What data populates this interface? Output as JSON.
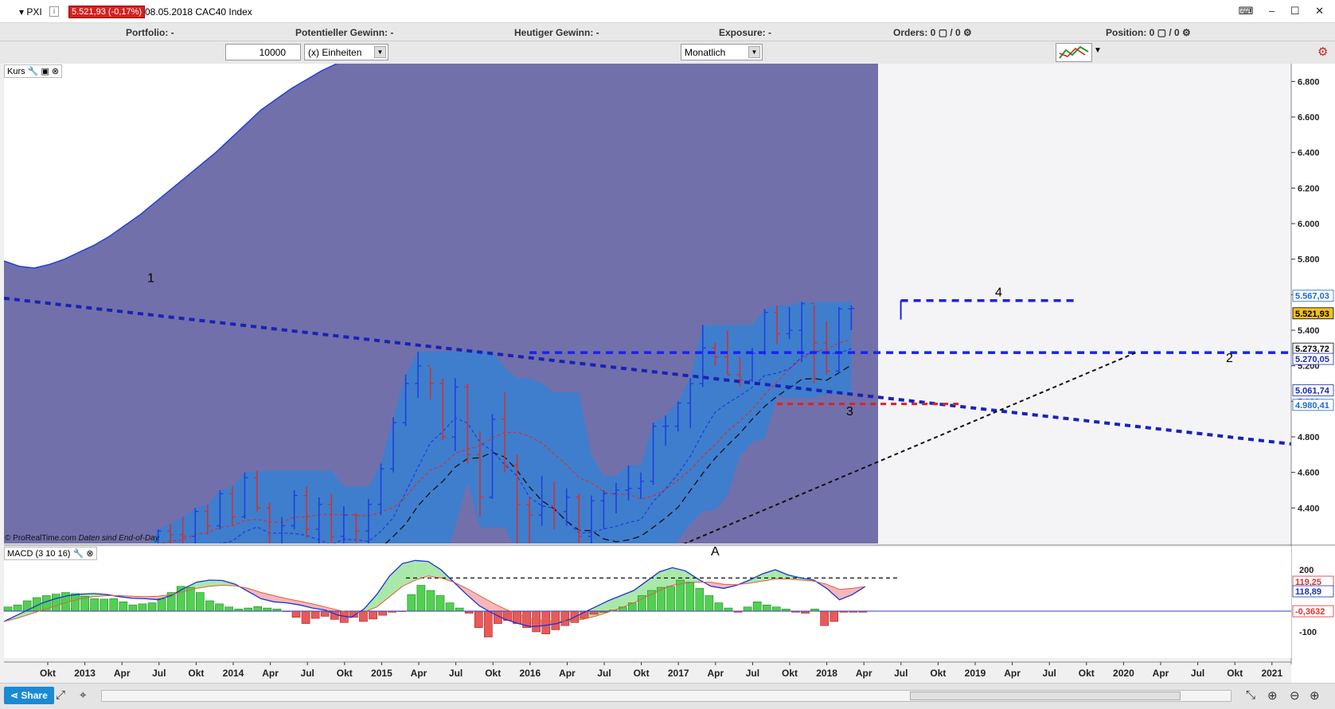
{
  "header": {
    "symbol": "▾ PXI",
    "info_label": "i",
    "price_badge": "5.521,93 (-0,17%)",
    "date_instrument": "08.05.2018 CAC40 Index",
    "window_controls": "⌨ – ☐ ✕"
  },
  "status": {
    "portfolio": "Portfolio: -",
    "potential_gain": "Potentieller Gewinn: -",
    "today_gain": "Heutiger Gewinn: -",
    "exposure": "Exposure: -",
    "orders": "Orders: 0 ▢ / 0 ⚙",
    "position": "Position: 0 ▢ / 0 ⚙"
  },
  "toolbar": {
    "quantity": "10000",
    "unit_select": "(x) Einheiten",
    "period_select": "Monatlich"
  },
  "panels": {
    "price_label": "Kurs",
    "macd_label": "MACD (3 10 16)",
    "copyright": "© ProRealTime.com",
    "copyright_note": "Daten sind End-of-Day"
  },
  "bottom": {
    "share_label": "Share"
  },
  "colors": {
    "band_fill": "#3a7fd0",
    "purple_bg": "#7270aa",
    "bar_up": "#1f3fe0",
    "bar_down": "#d43030",
    "trend_line": "#1a22b8",
    "macd_pos": "#52d052",
    "macd_neg": "#e85a5a"
  },
  "chart_data": {
    "type": "bar",
    "title": "CAC40 Index",
    "period": "Monatlich",
    "ylim": [
      4200,
      6900
    ],
    "y_ticks": [
      "4.400",
      "4.600",
      "4.800",
      "5.000",
      "5.200",
      "5.400",
      "5.600",
      "5.800",
      "6.000",
      "6.200",
      "6.400",
      "6.600",
      "6.800"
    ],
    "x_ticks": [
      "Okt",
      "2013",
      "Apr",
      "Jul",
      "Okt",
      "2014",
      "Apr",
      "Jul",
      "Okt",
      "2015",
      "Apr",
      "Jul",
      "Okt",
      "2016",
      "Apr",
      "Jul",
      "Okt",
      "2017",
      "Apr",
      "Jul",
      "Okt",
      "2018",
      "Apr",
      "Jul",
      "Okt",
      "2019",
      "Apr",
      "Jul",
      "Okt",
      "2020",
      "Apr",
      "Jul",
      "Okt",
      "2021"
    ],
    "price_labels": [
      {
        "text": "5.567,03",
        "value": 5567,
        "style": "blue"
      },
      {
        "text": "5.521,93",
        "value": 5522,
        "style": "current"
      },
      {
        "text": "5.273,72",
        "value": 5274,
        "style": "black"
      },
      {
        "text": "5.270,05",
        "value": 5270,
        "style": "navy"
      },
      {
        "text": "5.061,74",
        "value": 5062,
        "style": "navy"
      },
      {
        "text": "4.980,41",
        "value": 4980,
        "style": "blue"
      }
    ],
    "annotations": [
      "1",
      "2",
      "3",
      "4",
      "A"
    ],
    "ohlc_monthly": [
      [
        4100,
        4150,
        4050,
        4120
      ],
      [
        4125,
        4280,
        4110,
        4270
      ],
      [
        4270,
        4310,
        4200,
        4250
      ],
      [
        4250,
        4350,
        4180,
        4240
      ],
      [
        4240,
        4400,
        4200,
        4380
      ],
      [
        4380,
        4420,
        4250,
        4300
      ],
      [
        4300,
        4500,
        4280,
        4480
      ],
      [
        4480,
        4520,
        4300,
        4350
      ],
      [
        4350,
        4600,
        4340,
        4570
      ],
      [
        4570,
        4610,
        4380,
        4400
      ],
      [
        4400,
        4430,
        4160,
        4170
      ],
      [
        4170,
        4350,
        4090,
        4300
      ],
      [
        4300,
        4500,
        4280,
        4470
      ],
      [
        4470,
        4520,
        4230,
        4280
      ],
      [
        4280,
        4460,
        4200,
        4420
      ],
      [
        4420,
        4480,
        4180,
        4240
      ],
      [
        4240,
        4410,
        4160,
        4360
      ],
      [
        4360,
        4370,
        4130,
        4270
      ],
      [
        4270,
        4450,
        4100,
        4420
      ],
      [
        4420,
        4650,
        4360,
        4620
      ],
      [
        4620,
        4910,
        4600,
        4880
      ],
      [
        4880,
        5150,
        4860,
        5100
      ],
      [
        5100,
        5280,
        5020,
        5200
      ],
      [
        5200,
        5190,
        5010,
        5100
      ],
      [
        5100,
        5130,
        4780,
        4800
      ],
      [
        4800,
        5130,
        4720,
        5080
      ],
      [
        5080,
        5100,
        4650,
        4700
      ],
      [
        4700,
        4830,
        4350,
        4460
      ],
      [
        4460,
        4930,
        4450,
        4900
      ],
      [
        4900,
        5050,
        4600,
        4640
      ],
      [
        4640,
        4700,
        4200,
        4420
      ],
      [
        4420,
        4460,
        3900,
        4360
      ],
      [
        4360,
        4580,
        4300,
        4410
      ],
      [
        4410,
        4550,
        4280,
        4380
      ],
      [
        4380,
        4510,
        4300,
        4460
      ],
      [
        4460,
        4480,
        3900,
        4240
      ],
      [
        4240,
        4470,
        4150,
        4440
      ],
      [
        4440,
        4500,
        4280,
        4480
      ],
      [
        4480,
        4540,
        4370,
        4500
      ],
      [
        4500,
        4640,
        4440,
        4510
      ],
      [
        4510,
        4600,
        4450,
        4550
      ],
      [
        4550,
        4880,
        4530,
        4860
      ],
      [
        4860,
        4920,
        4750,
        4860
      ],
      [
        4860,
        5000,
        4830,
        4990
      ],
      [
        4990,
        5130,
        4850,
        5100
      ],
      [
        5100,
        5430,
        5080,
        5300
      ],
      [
        5300,
        5330,
        5200,
        5250
      ],
      [
        5250,
        5400,
        5150,
        5150
      ],
      [
        5150,
        5250,
        5080,
        5120
      ],
      [
        5120,
        5300,
        5110,
        5270
      ],
      [
        5270,
        5520,
        5260,
        5500
      ],
      [
        5500,
        5540,
        5320,
        5380
      ],
      [
        5380,
        5530,
        5350,
        5400
      ],
      [
        5400,
        5560,
        5220,
        5550
      ],
      [
        5550,
        5540,
        5100,
        5330
      ],
      [
        5330,
        5450,
        5150,
        5170
      ],
      [
        5170,
        5530,
        5160,
        5520
      ],
      [
        5520,
        5540,
        5400,
        5522
      ]
    ]
  },
  "macd_data": {
    "ylim": [
      -200,
      300
    ],
    "y_ticks": [
      "200",
      "100",
      "-100"
    ],
    "labels": [
      {
        "text": "119,25",
        "value": 119,
        "style": "red"
      },
      {
        "text": "118,89",
        "value": 119,
        "style": "blue"
      },
      {
        "text": "-0,3632",
        "value": -0.36,
        "style": "zero"
      }
    ],
    "histogram": [
      20,
      30,
      50,
      65,
      75,
      82,
      90,
      85,
      72,
      60,
      58,
      60,
      45,
      30,
      35,
      40,
      60,
      90,
      120,
      115,
      90,
      50,
      35,
      20,
      10,
      15,
      22,
      15,
      10,
      -2,
      -30,
      -60,
      -35,
      -25,
      -40,
      -55,
      -30,
      -50,
      -38,
      -20,
      -5,
      -2,
      80,
      125,
      100,
      75,
      40,
      15,
      -10,
      -80,
      -125,
      -60,
      -45,
      -60,
      -80,
      -100,
      -110,
      -90,
      -70,
      -55,
      -35,
      -15,
      -5,
      5,
      20,
      40,
      75,
      100,
      115,
      120,
      150,
      140,
      110,
      75,
      40,
      15,
      -5,
      20,
      45,
      30,
      20,
      10,
      -5,
      -10,
      10,
      -70,
      -50,
      -5,
      -5,
      -5,
      0
    ],
    "macd_line": [
      -50,
      -20,
      10,
      40,
      60,
      75,
      82,
      85,
      80,
      70,
      62,
      60,
      55,
      75,
      110,
      140,
      150,
      148,
      130,
      95,
      60,
      45,
      40,
      30,
      15,
      5,
      -20,
      -30,
      10,
      80,
      170,
      230,
      245,
      240,
      200,
      140,
      80,
      25,
      -10,
      -40,
      -60,
      -75,
      -70,
      -60,
      -40,
      -10,
      20,
      50,
      75,
      100,
      145,
      190,
      210,
      195,
      155,
      120,
      110,
      125,
      150,
      180,
      200,
      175,
      160,
      150,
      110,
      55,
      80,
      119
    ],
    "signal_line": [
      -50,
      -35,
      -15,
      5,
      25,
      45,
      60,
      70,
      75,
      75,
      72,
      70,
      72,
      80,
      95,
      110,
      120,
      125,
      122,
      110,
      90,
      75,
      60,
      48,
      35,
      20,
      5,
      -10,
      -5,
      20,
      70,
      120,
      150,
      170,
      160,
      140,
      110,
      75,
      40,
      10,
      -15,
      -35,
      -45,
      -50,
      -48,
      -40,
      -25,
      -5,
      15,
      40,
      70,
      100,
      125,
      135,
      140,
      140,
      130,
      128,
      135,
      145,
      155,
      155,
      150,
      145,
      130,
      105,
      110,
      119
    ]
  }
}
